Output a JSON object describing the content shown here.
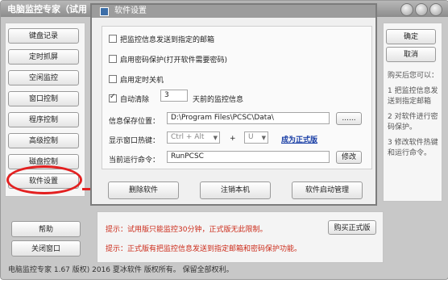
{
  "app": {
    "title": "电脑监控专家（试用"
  },
  "sidebar": {
    "items": [
      {
        "label": "键盘记录"
      },
      {
        "label": "定时抓屏"
      },
      {
        "label": "空闲监控"
      },
      {
        "label": "窗口控制"
      },
      {
        "label": "程序控制"
      },
      {
        "label": "高级控制"
      },
      {
        "label": "磁盘控制"
      },
      {
        "label": "软件设置"
      }
    ],
    "help_label": "帮助",
    "close_label": "关闭窗口"
  },
  "dialog": {
    "title": "软件设置",
    "opt_email": "把监控信息发送到指定的邮箱",
    "opt_email_checked": false,
    "opt_password": "启用密码保护(打开软件需要密码)",
    "opt_password_checked": false,
    "opt_shutdown": "启用定时关机",
    "opt_shutdown_checked": false,
    "opt_autoclear": "自动清除",
    "opt_autoclear_checked": true,
    "autoclear_days": "3",
    "autoclear_suffix": "天前的监控信息",
    "save_location_label": "信息保存位置：",
    "save_location_value": "D:\\Program Files\\PCSC\\Data\\",
    "browse_label": "......",
    "hotkey_label": "显示窗口热键：",
    "hotkey_modifier": "Ctrl + Alt",
    "hotkey_plus": "+",
    "hotkey_key": "U",
    "upgrade_link": "成为正式版",
    "run_command_label": "当前运行命令：",
    "run_command_value": "RunPCSC",
    "modify_label": "修改",
    "delete_label": "删除软件",
    "register_label": "注销本机",
    "startup_label": "软件启动管理"
  },
  "right_panel": {
    "ok_label": "确定",
    "cancel_label": "取消",
    "help_intro": "购买后您可以：",
    "help_1": "1 把监控信息发送到指定邮箱",
    "help_2": "2 对软件进行密码保护。",
    "help_3": "3 修改软件热键和运行命令。"
  },
  "tips": {
    "tip1": "提示：试用版只能监控30分钟，正式版无此限制。",
    "tip2": "提示：正式版有把监控信息发送到指定邮箱和密码保护功能。",
    "buy_label": "购买正式版"
  },
  "status": {
    "text": "电脑监控专家  1.67  版权)  2016 夏冰软件 版权所有。 保留全部权利。"
  },
  "colors": {
    "tip_red": "#cc2b1a",
    "highlight_red": "#e32020",
    "link_blue": "#1a3fa6"
  }
}
